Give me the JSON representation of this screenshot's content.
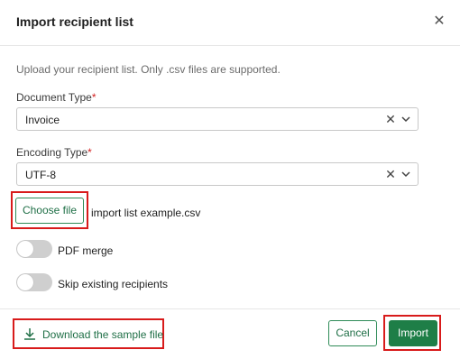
{
  "dialog": {
    "title": "Import recipient list",
    "close_icon": "close-icon",
    "hint": "Upload your recipient list. Only .csv files are supported."
  },
  "document_type": {
    "label": "Document Type",
    "required_mark": "*",
    "value": "Invoice"
  },
  "encoding_type": {
    "label": "Encoding Type",
    "required_mark": "*",
    "value": "UTF-8"
  },
  "file": {
    "button_label": "Choose file",
    "filename": "import list example.csv"
  },
  "toggles": {
    "pdf_merge": {
      "label": "PDF merge",
      "on": false
    },
    "skip_existing": {
      "label": "Skip existing recipients",
      "on": false
    }
  },
  "footer": {
    "download_label": "Download the sample file",
    "download_icon": "download-icon",
    "cancel_label": "Cancel",
    "import_label": "Import"
  },
  "colors": {
    "accent": "#1e7e47",
    "highlight": "#d81b1b",
    "required": "#d32020"
  }
}
